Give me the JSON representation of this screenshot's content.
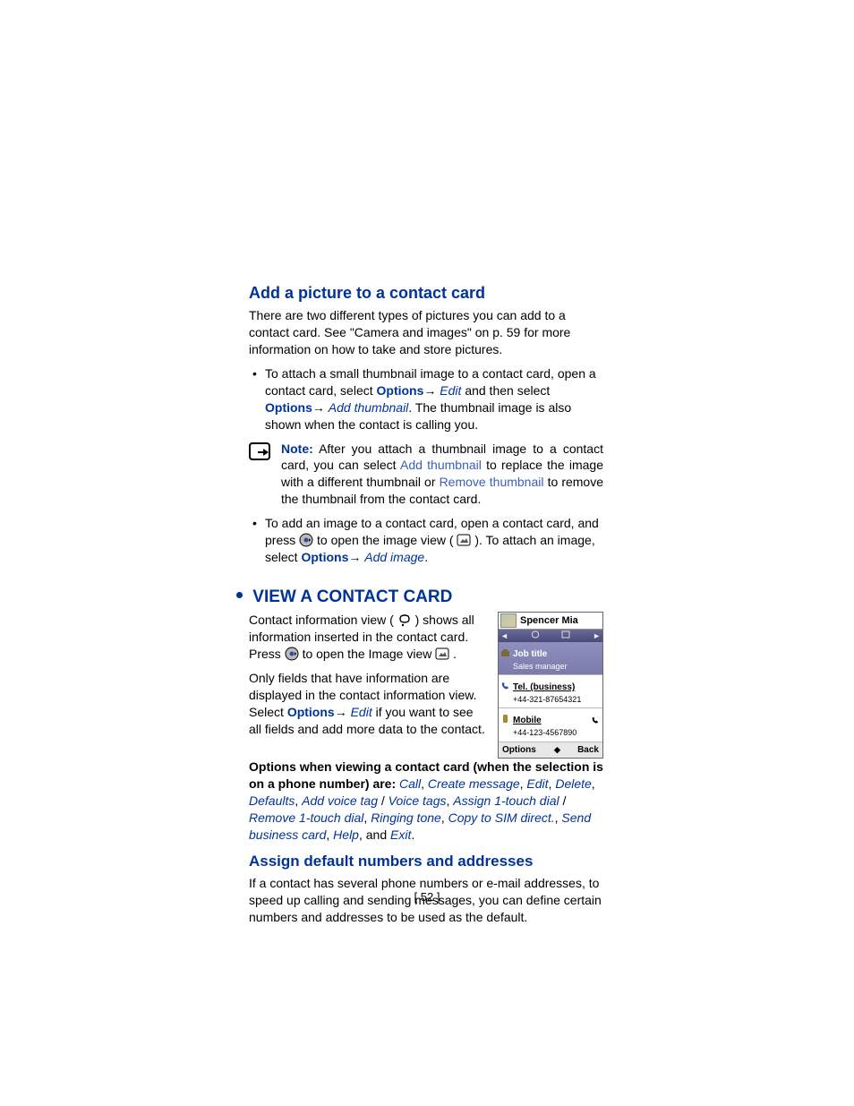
{
  "sec1": {
    "title": "Add a picture to a contact card",
    "intro": "There are two different types of pictures you can add to a contact card. See \"Camera and images\" on p. 59 for more information on how to take and store pictures.",
    "bullet1": {
      "a": "To attach a small thumbnail image to a contact card, open a contact card, select ",
      "options1": "Options",
      "edit": "Edit",
      "mid": " and then select ",
      "options2": "Options",
      "addthumb": "Add thumbnail",
      "c": ". The thumbnail image is also shown when the contact is calling you."
    },
    "note": {
      "label": "Note:",
      "a": " After you attach a thumbnail image to a contact card, you can select ",
      "addthumb": "Add thumbnail",
      "b": " to replace the image with a different thumbnail or ",
      "remthumb": "Remove thumbnail",
      "c": " to remove the thumbnail from the contact card."
    },
    "bullet2": {
      "a": "To add an image to a contact card, open a contact card, and press ",
      "b": " to open the image view (",
      "c": "). To attach an image, select ",
      "options": "Options",
      "addimage": "Add image",
      "d": "."
    }
  },
  "sec2": {
    "title": "View a contact card",
    "p1a": "Contact information view (",
    "p1b": ") shows all information inserted in the contact card. Press ",
    "p1c": " to open the Image view ",
    "p1d": ".",
    "p2a": "Only fields that have information are displayed in the contact information view. Select ",
    "p2_options": "Options",
    "p2_edit": "Edit",
    "p2b": " if you want to see all fields and add more data to the contact.",
    "opts": {
      "lead": "Options when viewing a contact card (when the selection is on a phone number) are: ",
      "items": [
        "Call",
        "Create message",
        "Edit",
        "Delete",
        "Defaults",
        "Add voice tag",
        "Voice tags",
        "Assign 1-touch dial",
        "Remove 1-touch dial",
        "Ringing tone",
        "Copy to SIM direct.",
        "Send business card",
        "Help",
        "Exit"
      ],
      "tail": "and"
    }
  },
  "sec3": {
    "title": "Assign default numbers and addresses",
    "p": "If a contact has several phone numbers or e-mail addresses, to speed up calling and sending messages, you can define certain numbers and addresses to be used as the default."
  },
  "phonefig": {
    "name": "Spencer Mia",
    "tab_left": "◄",
    "tab_right": "►",
    "jobtitle_lbl": "Job title",
    "jobtitle_val": "Sales manager",
    "tel_lbl": "Tel. (business)",
    "tel_val": "+44-321-87654321",
    "mob_lbl": "Mobile",
    "mob_val": "+44-123-4567890",
    "soft_left": "Options",
    "soft_mid": "◆",
    "soft_right": "Back"
  },
  "pagenum": "[ 52 ]"
}
